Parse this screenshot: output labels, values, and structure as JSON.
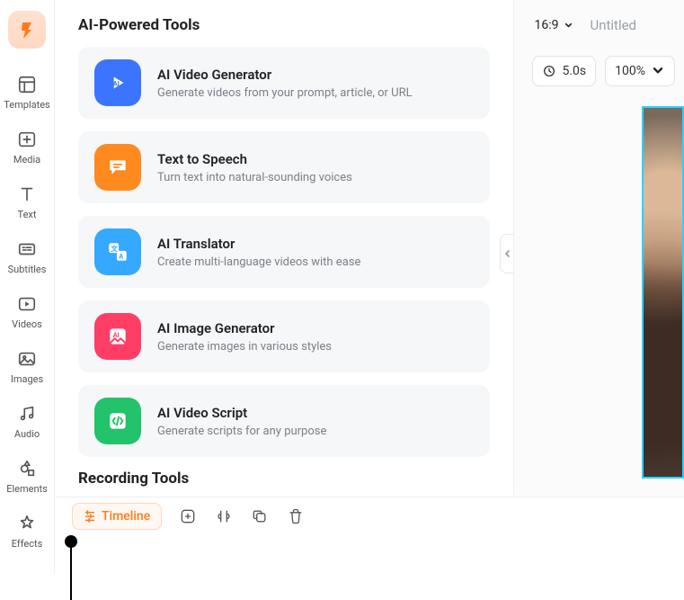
{
  "nav": {
    "items": [
      {
        "label": "Templates"
      },
      {
        "label": "Media"
      },
      {
        "label": "Text"
      },
      {
        "label": "Subtitles"
      },
      {
        "label": "Videos"
      },
      {
        "label": "Images"
      },
      {
        "label": "Audio"
      },
      {
        "label": "Elements"
      },
      {
        "label": "Effects"
      }
    ]
  },
  "panel": {
    "section1_title": "AI-Powered Tools",
    "tools": [
      {
        "title": "AI Video Generator",
        "desc": "Generate videos from your prompt, article, or URL"
      },
      {
        "title": "Text to Speech",
        "desc": "Turn text into natural-sounding voices"
      },
      {
        "title": "AI Translator",
        "desc": "Create multi-language videos with ease"
      },
      {
        "title": "AI Image Generator",
        "desc": "Generate images in various styles"
      },
      {
        "title": "AI Video Script",
        "desc": "Generate scripts for any purpose"
      }
    ],
    "section2_title": "Recording Tools"
  },
  "preview": {
    "aspect_label": "16:9",
    "title": "Untitled",
    "duration_label": "5.0s",
    "zoom_label": "100%"
  },
  "bottom": {
    "timeline_label": "Timeline"
  },
  "colors": {
    "accent": "#ff7a1a",
    "selection": "#26d4ff"
  }
}
